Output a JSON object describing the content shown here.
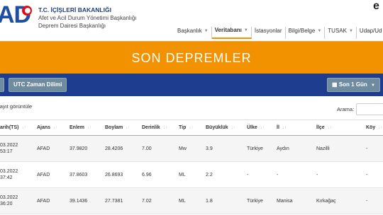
{
  "header": {
    "logo": "AD",
    "org_title": "T.C. İÇİŞLERİ BAKANLIĞI",
    "org_line2": "Afet ve Acil Durum Yönetimi Başkanlığı",
    "org_line3": "Deprem Dairesi Başkanlığı",
    "corner_letter": "e"
  },
  "nav": {
    "items": [
      {
        "label": "Başkanlık",
        "caret": true
      },
      {
        "label": "Veritabanı",
        "caret": true
      },
      {
        "label": "İstasyonlar",
        "caret": false
      },
      {
        "label": "Bilgi/Belge",
        "caret": true
      },
      {
        "label": "TUSAK",
        "caret": true
      },
      {
        "label": "Udap/Ud",
        "caret": false
      }
    ]
  },
  "banner": {
    "title": "SON DEPREMLER"
  },
  "toolbar": {
    "utc_button": "UTC Zaman Dilimi",
    "last_button": "Son 1 Gün"
  },
  "table_info": {
    "records_text": "kayıt görüntüle",
    "search_label": "Arama:"
  },
  "columns": [
    "arih(TS)",
    "Ajans",
    "Enlem",
    "Boylam",
    "Derinlik",
    "Tip",
    "Büyüklük",
    "Ülke",
    "İl",
    "İlçe",
    "Köy"
  ],
  "rows": [
    {
      "date1": "03.2022",
      "date2": "53:17",
      "agency": "AFAD",
      "lat": "37.9820",
      "lon": "28.4206",
      "depth": "7.00",
      "type": "Mw",
      "mag": "3.9",
      "country": "Türkiye",
      "province": "Aydın",
      "district": "Nazilli",
      "village": "-"
    },
    {
      "date1": "03.2022",
      "date2": "37:42",
      "agency": "AFAD",
      "lat": "37.8603",
      "lon": "26.8693",
      "depth": "6.96",
      "type": "ML",
      "mag": "2.2",
      "country": "-",
      "province": "-",
      "district": "-",
      "village": "-"
    },
    {
      "date1": "03.2022",
      "date2": "36:20",
      "agency": "AFAD",
      "lat": "39.1436",
      "lon": "27.7381",
      "depth": "7.02",
      "type": "ML",
      "mag": "1.8",
      "country": "Türkiye",
      "province": "Manisa",
      "district": "Kırkağaç",
      "village": "-"
    }
  ]
}
